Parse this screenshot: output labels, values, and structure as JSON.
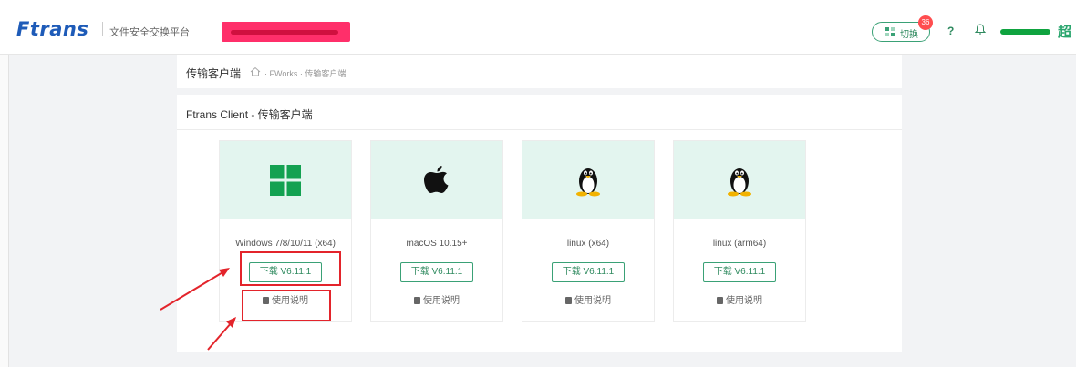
{
  "header": {
    "logo": "Ftrans",
    "subtitle": "文件安全交换平台",
    "switch_label": "切换",
    "notification_count": "36",
    "help": "?",
    "avatar_char": "超"
  },
  "breadcrumb": {
    "title": "传输客户端",
    "path": "· FWorks · 传输客户端"
  },
  "main": {
    "title": "Ftrans Client - 传输客户端",
    "clients": [
      {
        "os": "Windows 7/8/10/11 (x64)",
        "icon": "windows-icon",
        "download_label": "下载 V6.11.1",
        "manual_label": "使用说明"
      },
      {
        "os": "macOS 10.15+",
        "icon": "apple-icon",
        "download_label": "下载 V6.11.1",
        "manual_label": "使用说明"
      },
      {
        "os": "linux (x64)",
        "icon": "linux-tux-icon",
        "download_label": "下载 V6.11.1",
        "manual_label": "使用说明"
      },
      {
        "os": "linux (arm64)",
        "icon": "linux-tux-icon",
        "download_label": "下载 V6.11.1",
        "manual_label": "使用说明"
      }
    ]
  },
  "colors": {
    "brand": "#1e5bb8",
    "accent": "#3aa176",
    "card_art_bg": "#e3f5ef",
    "annotation": "#e3242b"
  }
}
